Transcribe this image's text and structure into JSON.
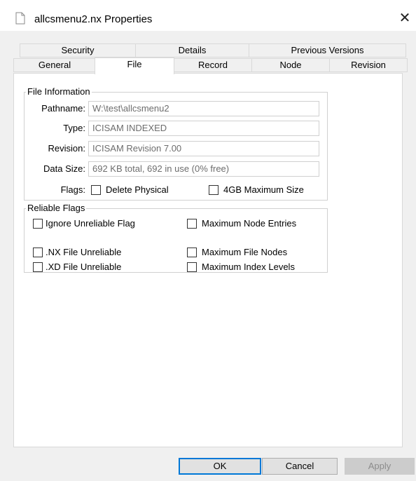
{
  "window": {
    "title": "allcsmenu2.nx Properties",
    "close_icon": "close-icon"
  },
  "tabs": {
    "row1": [
      {
        "label": "Security"
      },
      {
        "label": "Details"
      },
      {
        "label": "Previous Versions"
      }
    ],
    "row2": [
      {
        "label": "General"
      },
      {
        "label": "File"
      },
      {
        "label": "Record"
      },
      {
        "label": "Node"
      },
      {
        "label": "Revision"
      }
    ],
    "active": "File"
  },
  "file_info": {
    "group_title": "File Information",
    "pathname_label": "Pathname:",
    "pathname_value": "W:\\test\\allcsmenu2",
    "type_label": "Type:",
    "type_value": "ICISAM INDEXED",
    "revision_label": "Revision:",
    "revision_value": "ICISAM Revision  7.00",
    "datasize_label": "Data Size:",
    "datasize_value": "692 KB total, 692 in use (0% free)",
    "flags_label": "Flags:",
    "flag_delete_physical": "Delete Physical",
    "flag_4gb": "4GB Maximum Size"
  },
  "reliable_flags": {
    "group_title": "Reliable Flags",
    "ignore_unreliable": "Ignore Unreliable Flag",
    "max_node_entries": "Maximum Node Entries",
    "nx_unreliable": ".NX File Unreliable",
    "max_file_nodes": "Maximum File Nodes",
    "xd_unreliable": ".XD File Unreliable",
    "max_index_levels": "Maximum Index Levels"
  },
  "buttons": {
    "ok": "OK",
    "cancel": "Cancel",
    "apply": "Apply"
  }
}
